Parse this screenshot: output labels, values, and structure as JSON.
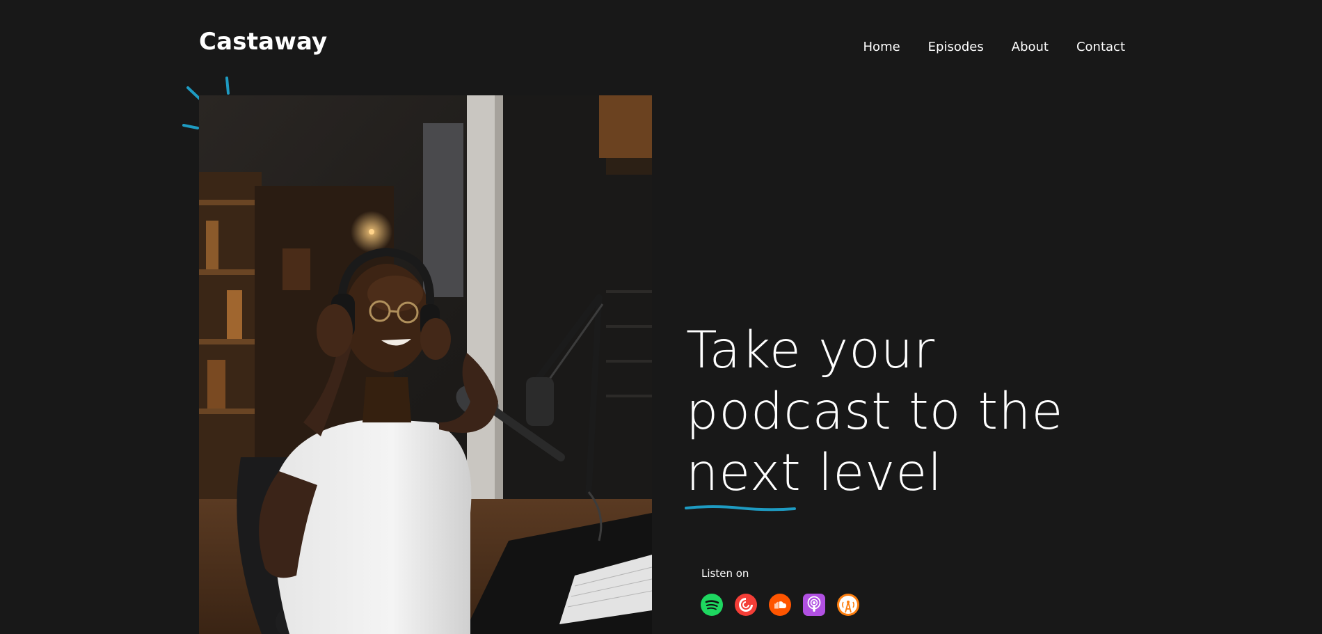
{
  "header": {
    "logo": "Castaway",
    "nav": [
      {
        "label": "Home"
      },
      {
        "label": "Episodes"
      },
      {
        "label": "About"
      },
      {
        "label": "Contact"
      }
    ]
  },
  "hero": {
    "headline_line1": "Take your",
    "headline_line2": "podcast to the",
    "headline_word_underlined": "next",
    "headline_line3_rest": " level",
    "listen_label": "Listen on",
    "platforms": [
      {
        "name": "Spotify",
        "icon": "spotify-icon",
        "color": "#1ED760"
      },
      {
        "name": "Pocket Casts",
        "icon": "pocketcasts-icon",
        "color": "#F43E37"
      },
      {
        "name": "SoundCloud",
        "icon": "soundcloud-icon",
        "color": "#FF5500"
      },
      {
        "name": "Apple Podcasts",
        "icon": "apple-podcasts-icon",
        "color": "#B150E2"
      },
      {
        "name": "Overcast",
        "icon": "overcast-icon",
        "color": "#FC7E0F"
      }
    ]
  },
  "colors": {
    "background": "#181818",
    "text": "#FFFFFF",
    "accent": "#1E9BC2"
  }
}
